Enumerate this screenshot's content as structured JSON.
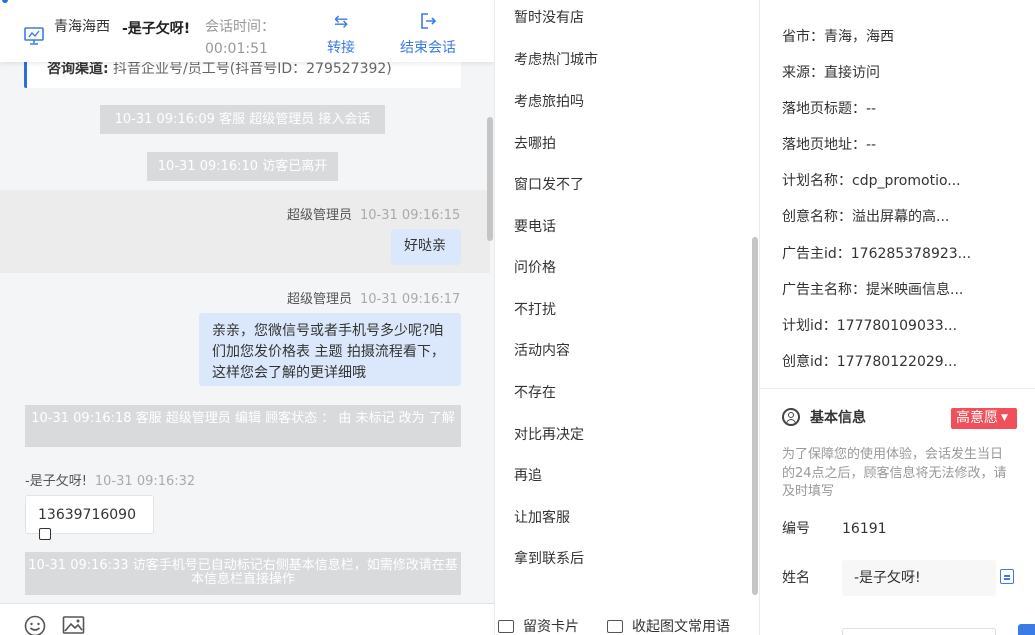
{
  "colors": {
    "accent": "#3b7be6",
    "intent_badge": "#f0505a",
    "system_pill": "#d9dadc",
    "agent_bubble": "#dbe8fb"
  },
  "header": {
    "region": "青海海西",
    "visitor_name": "-是子攵呀!",
    "time_label": "会话时间：",
    "duration": "00:01:51",
    "transfer_label": "转接",
    "end_label": "结束会话",
    "icons": {
      "monitor": "monitor-icon",
      "transfer": "transfer-icon",
      "end": "exit-icon"
    }
  },
  "chat": {
    "source_label": "咨询渠道:",
    "source_value": " 抖音企业号/员工号(抖音号ID：279527392)",
    "messages": [
      {
        "kind": "system",
        "text": "10-31 09:16:09 客服 超级管理员 接入会话"
      },
      {
        "kind": "system",
        "text": "10-31 09:16:10 访客已离开"
      },
      {
        "kind": "agent",
        "sender": "超级管理员",
        "time": "10-31 09:16:15",
        "text": "好哒亲"
      },
      {
        "kind": "agent",
        "sender": "超级管理员",
        "time": "10-31 09:16:17",
        "text": "亲亲，您微信号或者手机号多少呢?咱们加您发价格表 主题 拍摄流程看下，这样您会了解的更详细哦"
      },
      {
        "kind": "system",
        "text": "10-31 09:16:18 客服 超级管理员 编辑 顾客状态 ： 由 未标记 改为 了解"
      },
      {
        "kind": "visitor",
        "sender": "-是子攵呀!",
        "time": "10-31 09:16:32",
        "text": "13639716090"
      },
      {
        "kind": "system",
        "text": "10-31 09:16:33 访客手机号已自动标记右侧基本信息栏，如需修改请在基本信息栏直接操作"
      }
    ],
    "footer_icons": [
      "emoji-icon",
      "image-icon"
    ]
  },
  "quick_replies": {
    "items": [
      "暂时没有店",
      "考虑热门城市",
      "考虑旅拍吗",
      "去哪拍",
      "窗口发不了",
      "要电话",
      "问价格",
      "不打扰",
      "活动内容",
      "不存在",
      "对比再决定",
      "再追",
      "让加客服",
      "拿到联系后"
    ],
    "footer": {
      "card_label": "留资卡片",
      "collapse_label": "收起图文常用语"
    }
  },
  "visitor_info": {
    "rows": [
      "省市：青海，海西",
      "来源：直接访问",
      "落地页标题：--",
      "落地页地址：--",
      "计划名称：cdp_promotio...",
      "创意名称：溢出屏幕的高...",
      "广告主id：176285378923...",
      "广告主名称：提米映画信息...",
      "计划id：177780109033...",
      "创意id：177780122029..."
    ],
    "basic_info_title": "基本信息",
    "intent_badge": "高意愿",
    "notice": "为了保障您的使用体验，会话发生当日的24点之后，顾客信息将无法修改，请及时填写",
    "id_label": "编号",
    "id_value": "16191",
    "name_label": "姓名",
    "name_value": "-是子攵呀!"
  }
}
